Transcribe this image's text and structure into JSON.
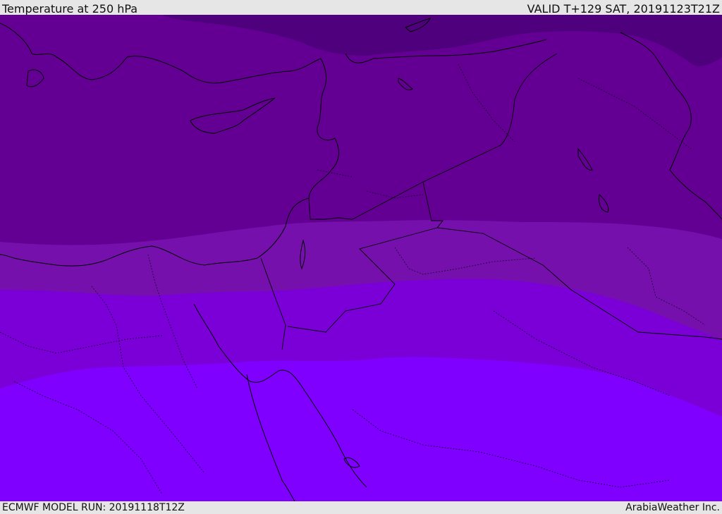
{
  "header": {
    "title": "Temperature at 250 hPa",
    "valid_time": "VALID T+129 SAT, 20191123T21Z"
  },
  "footer": {
    "model_run": "ECMWF MODEL RUN: 20191118T12Z",
    "credit": "ArabiaWeather Inc."
  },
  "map": {
    "colors": {
      "band_coldest": "#4f007d",
      "band_cold": "#630093",
      "band_mid": "#7510ad",
      "band_warm": "#7b00d8",
      "band_warmest": "#7f00ff",
      "coastline": "#000000",
      "border": "#1a0030"
    }
  }
}
